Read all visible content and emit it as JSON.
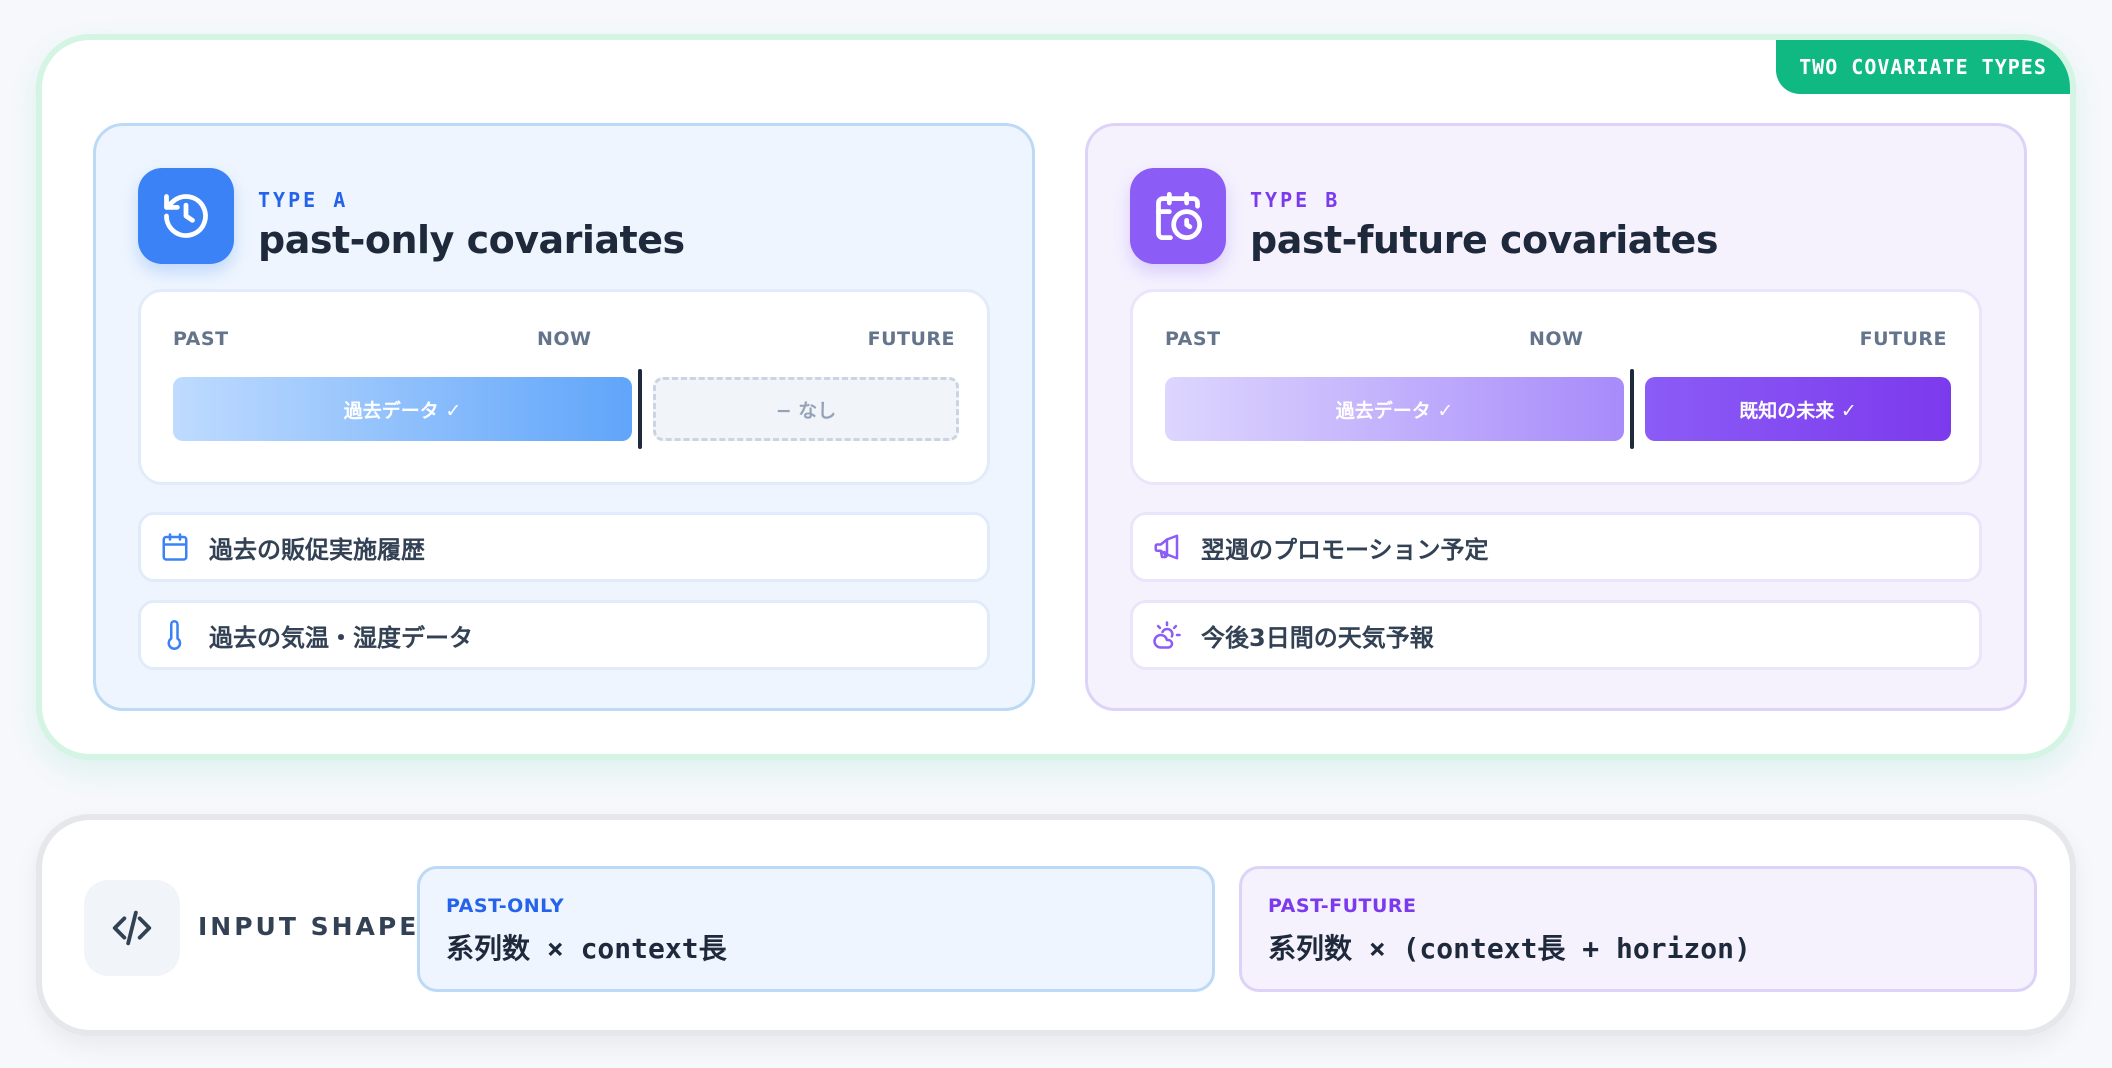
{
  "badge": "TWO COVARIATE TYPES",
  "type_a": {
    "icon": "history-icon",
    "label": "TYPE A",
    "title": "past-only covariates",
    "timeline": {
      "past": "PAST",
      "now": "NOW",
      "future": "FUTURE",
      "past_bar": "過去データ ✓",
      "future_bar": "− なし"
    },
    "examples": [
      {
        "icon": "calendar-icon",
        "text": "過去の販促実施履歴"
      },
      {
        "icon": "thermometer-icon",
        "text": "過去の気温・湿度データ"
      }
    ]
  },
  "type_b": {
    "icon": "calendar-clock-icon",
    "label": "TYPE B",
    "title": "past-future covariates",
    "timeline": {
      "past": "PAST",
      "now": "NOW",
      "future": "FUTURE",
      "past_bar": "過去データ ✓",
      "future_bar": "既知の未来 ✓"
    },
    "examples": [
      {
        "icon": "megaphone-icon",
        "text": "翌週のプロモーション予定"
      },
      {
        "icon": "sun-cloud-icon",
        "text": "今後3日間の天気予報"
      }
    ]
  },
  "input_shape": {
    "icon": "code-icon",
    "label": "INPUT SHAPE",
    "past_only": {
      "label": "PAST-ONLY",
      "formula": "系列数 × context長"
    },
    "past_future": {
      "label": "PAST-FUTURE",
      "formula": "系列数 × (context長 + horizon)"
    }
  },
  "colors": {
    "accent_green": "#10b981",
    "type_a_blue": "#3b82f6",
    "type_b_purple": "#8b5cf6"
  }
}
